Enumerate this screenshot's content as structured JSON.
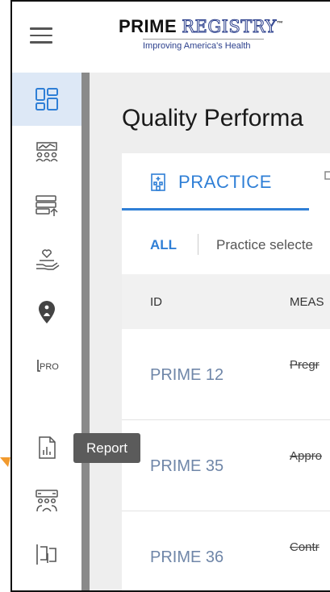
{
  "header": {
    "logo_bold": "PRIME",
    "logo_outline": "REGISTRY",
    "logo_tm": "™",
    "logo_tagline": "Improving America's Health"
  },
  "sidebar": {
    "items": [
      {
        "icon": "dashboard-icon",
        "active": true
      },
      {
        "icon": "patients-group-icon",
        "active": false
      },
      {
        "icon": "data-upload-icon",
        "active": false
      },
      {
        "icon": "care-heart-hand-icon",
        "active": false
      },
      {
        "icon": "location-pin-icon",
        "active": false
      },
      {
        "icon": "pro-icon",
        "active": false,
        "label": "PRO"
      },
      {
        "icon": "report-icon",
        "active": false
      },
      {
        "icon": "group-exchange-icon",
        "active": false
      },
      {
        "icon": "tracking-icon",
        "active": false
      }
    ]
  },
  "tooltip": {
    "text": "Report"
  },
  "main": {
    "page_title": "Quality Performa",
    "tabs": [
      {
        "label": "PRACTICE",
        "active": true
      }
    ],
    "filter": {
      "all_label": "ALL",
      "selected_text": "Practice selecte"
    },
    "table": {
      "headers": {
        "id": "ID",
        "measure": "MEAS"
      },
      "rows": [
        {
          "id": "PRIME 12",
          "measure": "Pregr"
        },
        {
          "id": "PRIME 35",
          "measure": "Appro"
        },
        {
          "id": "PRIME 36",
          "measure": "Contr"
        }
      ]
    }
  },
  "colors": {
    "accent": "#2f7fd6",
    "active_nav_bg": "#dde8f6",
    "tooltip_bg": "#5b5b5b",
    "arrow": "#f29a2e"
  }
}
